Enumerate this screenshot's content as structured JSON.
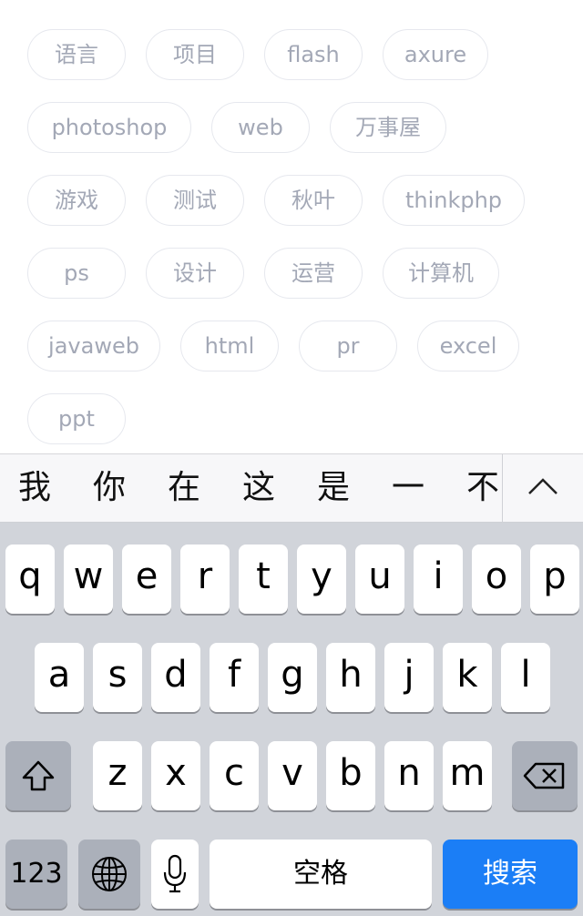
{
  "tags": [
    [
      "语言",
      "项目",
      "flash",
      "axure"
    ],
    [
      "photoshop",
      "web",
      "万事屋"
    ],
    [
      "游戏",
      "测试",
      "秋叶",
      "thinkphp"
    ],
    [
      "ps",
      "设计",
      "运营",
      "计算机"
    ],
    [
      "javaweb",
      "html",
      "pr",
      "excel"
    ],
    [
      "ppt"
    ]
  ],
  "candidates": [
    "我",
    "你",
    "在",
    "这",
    "是",
    "一",
    "不"
  ],
  "keyboard": {
    "row1": [
      "q",
      "w",
      "e",
      "r",
      "t",
      "y",
      "u",
      "i",
      "o",
      "p"
    ],
    "row2": [
      "a",
      "s",
      "d",
      "f",
      "g",
      "h",
      "j",
      "k",
      "l"
    ],
    "row3": [
      "z",
      "x",
      "c",
      "v",
      "b",
      "n",
      "m"
    ],
    "numbers": "123",
    "space": "空格",
    "search": "搜索"
  },
  "icons": {
    "shift": "shift-icon",
    "delete": "backspace-icon",
    "globe": "globe-icon",
    "mic": "microphone-icon",
    "collapse": "chevron-up-icon"
  },
  "colors": {
    "tag_text": "#a3a8b6",
    "tag_border": "#e6e8ee",
    "keyboard_bg": "#d1d4da",
    "search_key": "#1b7ef6"
  }
}
